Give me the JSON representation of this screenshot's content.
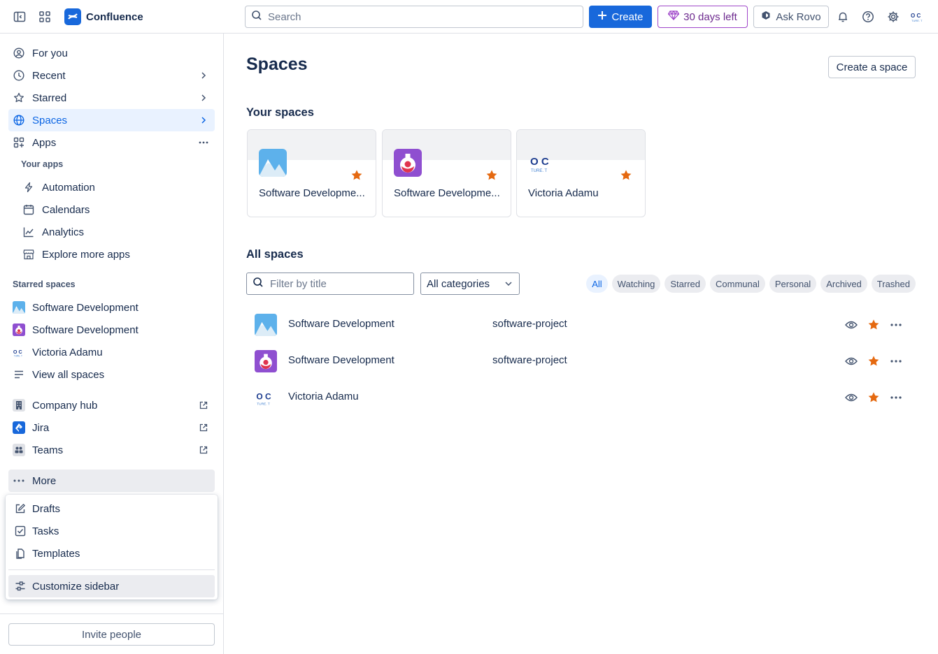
{
  "topbar": {
    "app_name": "Confluence",
    "search_placeholder": "Search",
    "create_label": "Create",
    "trial_label": "30 days left",
    "rovo_label": "Ask Rovo"
  },
  "sidebar": {
    "nav": [
      {
        "label": "For you"
      },
      {
        "label": "Recent"
      },
      {
        "label": "Starred"
      },
      {
        "label": "Spaces"
      },
      {
        "label": "Apps"
      }
    ],
    "your_apps_label": "Your apps",
    "apps": [
      {
        "label": "Automation"
      },
      {
        "label": "Calendars"
      },
      {
        "label": "Analytics"
      },
      {
        "label": "Explore more apps"
      }
    ],
    "starred_spaces_label": "Starred spaces",
    "starred_spaces": [
      {
        "label": "Software Development"
      },
      {
        "label": "Software Development"
      },
      {
        "label": "Victoria Adamu"
      },
      {
        "label": "View all spaces"
      }
    ],
    "external": [
      {
        "label": "Company hub"
      },
      {
        "label": "Jira"
      },
      {
        "label": "Teams"
      }
    ],
    "more_label": "More",
    "more_menu": [
      {
        "label": "Drafts"
      },
      {
        "label": "Tasks"
      },
      {
        "label": "Templates"
      },
      {
        "label": "Customize sidebar"
      }
    ],
    "invite_label": "Invite people"
  },
  "main": {
    "title": "Spaces",
    "create_space_label": "Create a space",
    "your_spaces_title": "Your spaces",
    "your_spaces": [
      {
        "title": "Software Developme..."
      },
      {
        "title": "Software Developme..."
      },
      {
        "title": "Victoria Adamu"
      }
    ],
    "all_spaces_title": "All spaces",
    "filter_placeholder": "Filter by title",
    "category_select": "All categories",
    "chips": [
      "All",
      "Watching",
      "Starred",
      "Communal",
      "Personal",
      "Archived",
      "Trashed"
    ],
    "rows": [
      {
        "name": "Software Development",
        "key": "software-project"
      },
      {
        "name": "Software Development",
        "key": "software-project"
      },
      {
        "name": "Victoria Adamu",
        "key": ""
      }
    ]
  },
  "colors": {
    "accent": "#1868db",
    "star": "#e56910",
    "trial": "#9f46c9",
    "active_bg": "#e9f2ff"
  }
}
